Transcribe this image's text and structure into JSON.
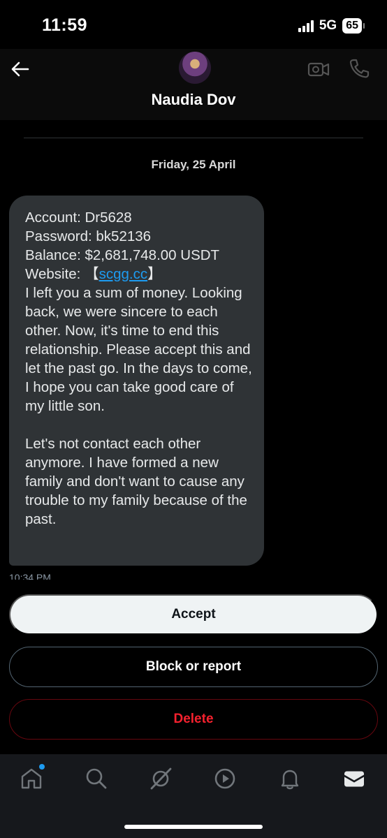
{
  "status_bar": {
    "time": "11:59",
    "network": "5G",
    "battery": "65"
  },
  "header": {
    "contact_name": "Naudia Dov"
  },
  "conversation": {
    "date_label": "Friday, 25 April",
    "message": {
      "account_line": "Account: Dr5628",
      "password_line": "Password: bk52136",
      "balance_line": "Balance: $2,681,748.00 USDT",
      "website_label": "Website:  【",
      "website_link": "scgg.cc",
      "website_close": "】",
      "paragraph1": "I left you a sum of money. Looking back, we were sincere to each other. Now, it's time to end this relationship. Please accept this and let the past go. In the days to come, I hope you can take good care of my little son.",
      "paragraph2": "Let's not contact each other anymore. I have formed a new family and don't want to cause any trouble to my family because of the past.",
      "timestamp": "10:34 PM"
    }
  },
  "actions": {
    "accept": "Accept",
    "block_report": "Block or report",
    "delete": "Delete"
  },
  "nav": {
    "items": [
      "home-icon",
      "search-icon",
      "grok-icon",
      "play-icon",
      "bell-icon",
      "mail-icon"
    ],
    "badge_color": "#1d9bf0"
  },
  "colors": {
    "link": "#1d9bf0",
    "delete": "#f4212e",
    "bubble": "#2f3336"
  }
}
